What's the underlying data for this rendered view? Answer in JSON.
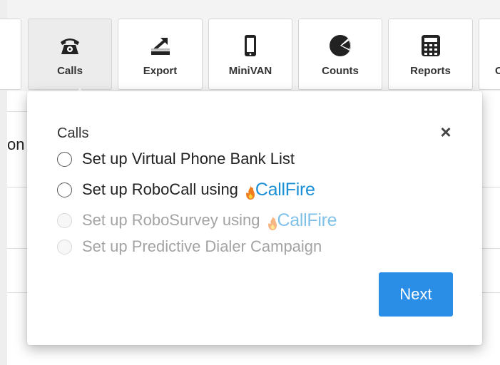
{
  "toolbar": {
    "buttons": [
      {
        "label": "",
        "icon": "partial-left-icon"
      },
      {
        "label": "Calls",
        "icon": "telephone-icon",
        "active": true
      },
      {
        "label": "Export",
        "icon": "export-icon"
      },
      {
        "label": "MiniVAN",
        "icon": "mobile-phone-icon"
      },
      {
        "label": "Counts",
        "icon": "pie-chart-icon"
      },
      {
        "label": "Reports",
        "icon": "calculator-icon"
      },
      {
        "label": "C",
        "icon": "partial-right-icon"
      }
    ]
  },
  "background": {
    "partial_text": "on"
  },
  "popup": {
    "title": "Calls",
    "close_icon": "×",
    "options": [
      {
        "label": "Set up Virtual Phone Bank List",
        "enabled": true
      },
      {
        "label": "Set up RoboCall using",
        "brand": "CallFire",
        "enabled": true
      },
      {
        "label": "Set up RoboSurvey using",
        "brand": "CallFire",
        "enabled": false
      },
      {
        "label": "Set up Predictive Dialer Campaign",
        "enabled": false
      }
    ],
    "next_label": "Next"
  },
  "colors": {
    "next_button": "#2b8ee6",
    "callfire_blue": "#1a8fd6",
    "callfire_flame": "#f07c1e",
    "disabled_text": "#a3a3a3"
  }
}
